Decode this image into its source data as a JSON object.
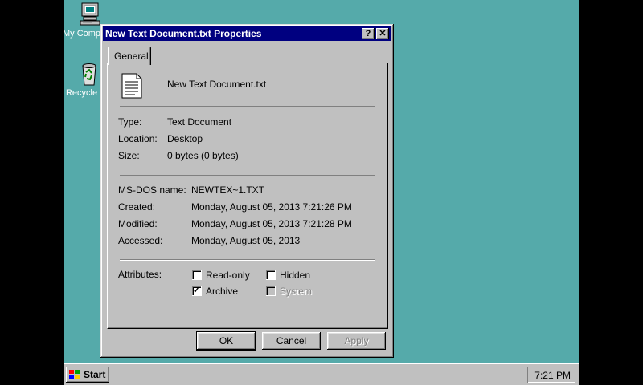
{
  "desktop": {
    "icons": [
      {
        "label": "My Computer",
        "icon": "computer-icon"
      },
      {
        "label": "Recycle Bin",
        "icon": "recycle-bin-icon"
      }
    ]
  },
  "dialog": {
    "title": "New Text Document.txt Properties",
    "help_button": "?",
    "close_button": "✕",
    "tab": "General",
    "file_icon": "text-file-icon",
    "file_name": "New Text Document.txt",
    "props": {
      "type_label": "Type:",
      "type_value": "Text Document",
      "location_label": "Location:",
      "location_value": "Desktop",
      "size_label": "Size:",
      "size_value": "0 bytes (0 bytes)",
      "msdos_label": "MS-DOS name:",
      "msdos_value": "NEWTEX~1.TXT",
      "created_label": "Created:",
      "created_value": "Monday, August 05, 2013 7:21:26 PM",
      "modified_label": "Modified:",
      "modified_value": "Monday, August 05, 2013 7:21:28 PM",
      "accessed_label": "Accessed:",
      "accessed_value": "Monday, August 05, 2013"
    },
    "attributes_label": "Attributes:",
    "attributes": {
      "read_only": {
        "label": "Read-only",
        "checked": false
      },
      "hidden": {
        "label": "Hidden",
        "checked": false
      },
      "archive": {
        "label": "Archive",
        "checked": true
      },
      "system": {
        "label": "System",
        "checked": false,
        "disabled": true
      }
    },
    "buttons": {
      "ok": "OK",
      "cancel": "Cancel",
      "apply": "Apply"
    }
  },
  "taskbar": {
    "start_label": "Start",
    "clock": "7:21 PM"
  },
  "colors": {
    "desktop": "#55aaaa",
    "titlebar": "#000080",
    "face": "#c0c0c0"
  }
}
